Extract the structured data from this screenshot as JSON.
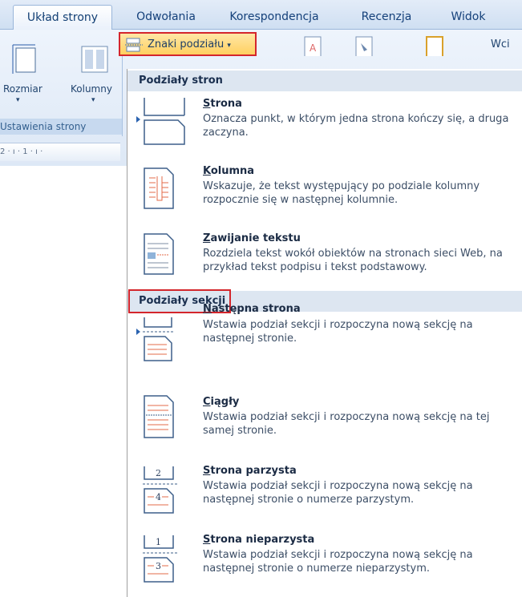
{
  "tabs": [
    {
      "label": "Układ strony",
      "active": true
    },
    {
      "label": "Odwołania"
    },
    {
      "label": "Korespondencja"
    },
    {
      "label": "Recenzja"
    },
    {
      "label": "Widok"
    }
  ],
  "ribbon": {
    "size_label": "Rozmiar",
    "columns_label": "Kolumny",
    "group_label": "Ustawienia strony",
    "ruler_text": "2 · ı · 1 · ı ·",
    "breaks_button_label": "Znaki podziału",
    "truncated_label": "Wci"
  },
  "menu": {
    "page_breaks_header": "Podziały stron",
    "section_breaks_header": "Podziały sekcji",
    "page_items": [
      {
        "key": "S",
        "rest": "trona",
        "description": "Oznacza punkt, w którym jedna strona kończy się, a druga zaczyna.",
        "icon": "page-break-icon"
      },
      {
        "key": "K",
        "rest": "olumna",
        "description": "Wskazuje, że tekst występujący po podziale kolumny rozpocznie się w następnej kolumnie.",
        "icon": "column-break-icon"
      },
      {
        "key": "Z",
        "rest": "awijanie tekstu",
        "description": "Rozdziela tekst wokół obiektów na stronach sieci Web, na przykład tekst podpisu i tekst podstawowy.",
        "icon": "text-wrapping-icon"
      }
    ],
    "section_items": [
      {
        "key": "N",
        "rest": "astępna strona",
        "description": "Wstawia podział sekcji i rozpoczyna nową sekcję na następnej stronie.",
        "icon": "next-page-icon"
      },
      {
        "key": "C",
        "rest": "iągły",
        "description": "Wstawia podział sekcji i rozpoczyna nową sekcję na tej samej stronie.",
        "icon": "continuous-icon"
      },
      {
        "key": "S",
        "rest": "trona parzysta",
        "description": "Wstawia podział sekcji i rozpoczyna nową sekcję na następnej stronie o numerze parzystym.",
        "icon": "even-page-icon",
        "num_top": "2",
        "num_bottom": "4"
      },
      {
        "key": "S",
        "rest": "trona nieparzysta",
        "description": "Wstawia podział sekcji i rozpoczyna nową sekcję na następnej stronie o numerze nieparzystym.",
        "icon": "odd-page-icon",
        "num_top": "1",
        "num_bottom": "3"
      }
    ]
  },
  "colors": {
    "accent": "#d4262c",
    "header_bg": "#dde6f1",
    "ribbon_bg": "#dde8f6"
  }
}
